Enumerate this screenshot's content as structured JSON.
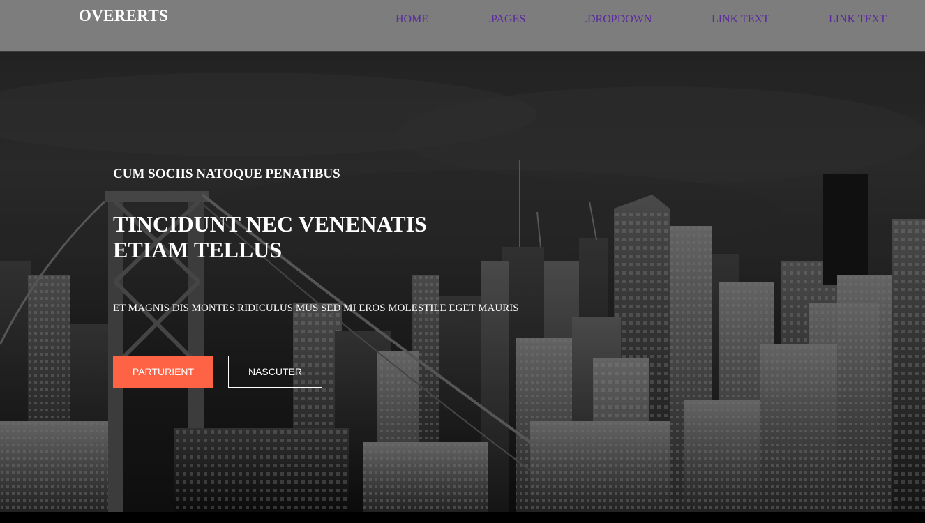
{
  "header": {
    "brand": "OVERERTS",
    "nav": {
      "home": "HOME",
      "pages": ".PAGES",
      "dropdown": ".DROPDOWN",
      "link4": "LINK TEXT",
      "link5": "LINK TEXT"
    }
  },
  "hero": {
    "kicker": "CUM SOCIIS NATOQUE PENATIBUS",
    "title_line1": "TINCIDUNT NEC VENENATIS",
    "title_line2": "ETIAM TELLUS",
    "description": "ET MAGNIS DIS MONTES RIDICULUS MUS SED MI EROS MOLESTILE EGET MAURIS",
    "primary_button": "PARTURIENT",
    "secondary_button": "NASCUTER"
  },
  "colors": {
    "header_bg": "#7d7d7d",
    "nav_link": "#5a2a9e",
    "accent": "#fe6346",
    "text": "#ffffff"
  }
}
